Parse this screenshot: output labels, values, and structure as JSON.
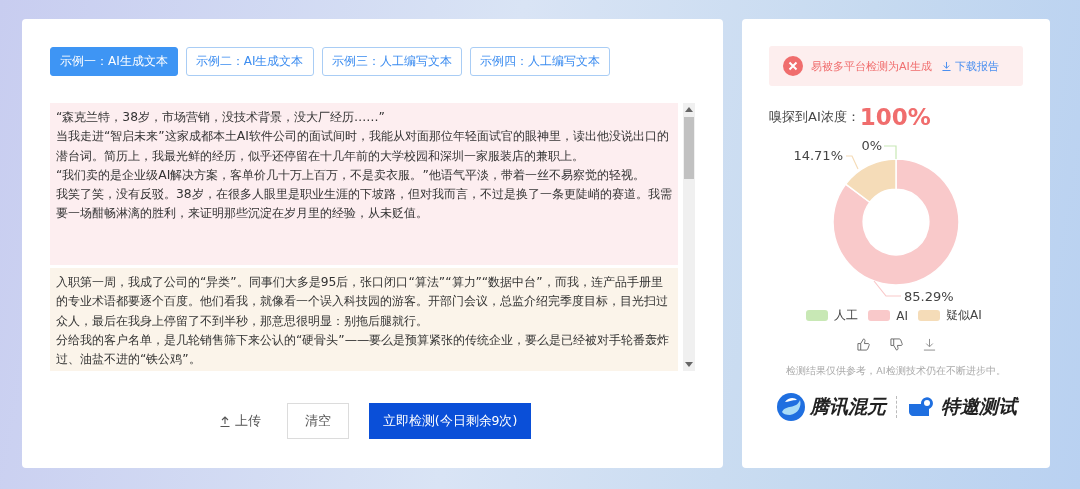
{
  "tabs": [
    {
      "label": "示例一：AI生成文本",
      "selected": true
    },
    {
      "label": "示例二：AI生成文本",
      "selected": false
    },
    {
      "label": "示例三：人工编写文本",
      "selected": false
    },
    {
      "label": "示例四：人工编写文本",
      "selected": false
    }
  ],
  "editor": {
    "blocks": [
      {
        "kind": "ai",
        "paragraphs": [
          "“森克兰特，38岁，市场营销，没技术背景，没大厂经历……”",
          "当我走进“智启未来”这家成都本土AI软件公司的面试间时，我能从对面那位年轻面试官的眼神里，读出他没说出口的潜台词。简历上，我最光鲜的经历，似乎还停留在十几年前的大学校园和深圳一家服装店的兼职上。",
          "“我们卖的是企业级AI解决方案，客单价几十万上百万，不是卖衣服。”他语气平淡，带着一丝不易察觉的轻视。",
          "我笑了笑，没有反驳。38岁，在很多人眼里是职业生涯的下坡路，但对我而言，不过是换了一条更陡峭的赛道。我需要一场酣畅淋漓的胜利，来证明那些沉淀在岁月里的经验，从未贬值。"
        ]
      },
      {
        "kind": "suspected",
        "paragraphs": [
          "入职第一周，我成了公司的“异类”。同事们大多是95后，张口闭口“算法”“算力”“数据中台”，而我，连产品手册里的专业术语都要逐个百度。他们看我，就像看一个误入科技园的游客。开部门会议，总监介绍完季度目标，目光扫过众人，最后在我身上停留了不到半秒，那意思很明显：别拖后腿就行。",
          "分给我的客户名单，是几轮销售筛下来公认的“硬骨头”——要么是预算紧张的传统企业，要么是已经被对手轮番轰炸过、油盐不进的“铁公鸡”。"
        ]
      }
    ]
  },
  "actions": {
    "upload": "上传",
    "clear": "清空",
    "detect": "立即检测(今日剩余9次)"
  },
  "result": {
    "verdict": "易被多平台检测为AI生成",
    "download": "下载报告",
    "concentration_label": "嗅探到AI浓度：",
    "concentration": "100%",
    "chart_data": {
      "type": "donut",
      "categories": [
        "人工",
        "AI",
        "疑似AI"
      ],
      "values": [
        0,
        85.29,
        14.71
      ],
      "colors": [
        "#c8e8b5",
        "#f9c9ca",
        "#f5dcb8"
      ],
      "value_labels": [
        "0%",
        "85.29%",
        "14.71%"
      ]
    },
    "disclaimer": "检测结果仅供参考，AI检测技术仍在不断进步中。",
    "brand": "腾讯混元",
    "badge": "特邀测试"
  }
}
